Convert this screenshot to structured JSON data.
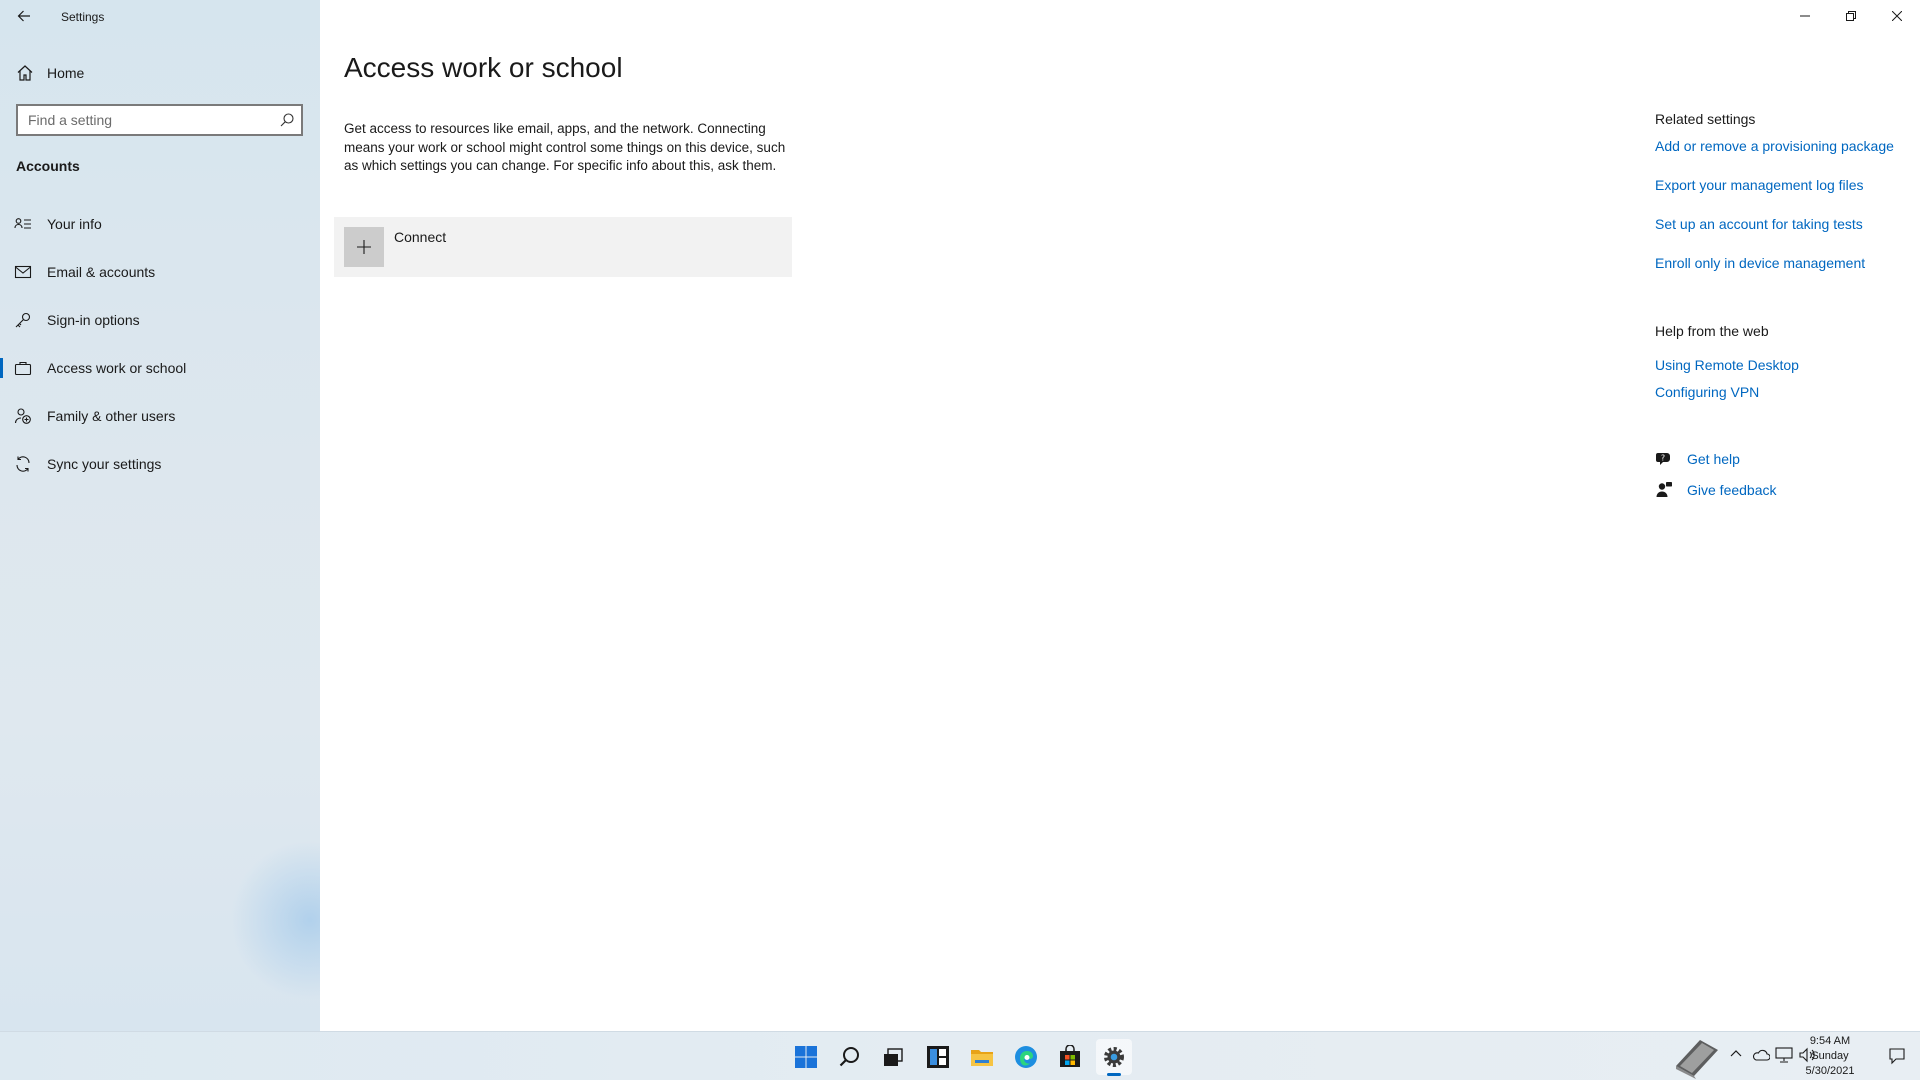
{
  "window": {
    "title": "Settings",
    "back_icon": "back-arrow-icon",
    "controls": [
      "minimize-icon",
      "restore-icon",
      "close-icon"
    ]
  },
  "sidebar": {
    "home_label": "Home",
    "search_placeholder": "Find a setting",
    "section_heading": "Accounts",
    "items": [
      {
        "label": "Your info",
        "icon": "contact-card-icon",
        "active": false
      },
      {
        "label": "Email & accounts",
        "icon": "mail-icon",
        "active": false
      },
      {
        "label": "Sign-in options",
        "icon": "key-icon",
        "active": false
      },
      {
        "label": "Access work or school",
        "icon": "briefcase-icon",
        "active": true
      },
      {
        "label": "Family & other users",
        "icon": "add-person-icon",
        "active": false
      },
      {
        "label": "Sync your settings",
        "icon": "sync-icon",
        "active": false
      }
    ]
  },
  "main": {
    "title": "Access work or school",
    "description": "Get access to resources like email, apps, and the network. Connecting means your work or school might control some things on this device, such as which settings you can change. For specific info about this, ask them.",
    "connect_label": "Connect"
  },
  "related": {
    "heading": "Related settings",
    "links": [
      "Add or remove a provisioning package",
      "Export your management log files",
      "Set up an account for taking tests",
      "Enroll only in device management"
    ],
    "help_heading": "Help from the web",
    "help_links": [
      "Using Remote Desktop",
      "Configuring VPN"
    ],
    "get_help": "Get help",
    "give_feedback": "Give feedback"
  },
  "taskbar": {
    "icons": [
      "start-icon",
      "search-icon",
      "task-view-icon",
      "widgets-icon",
      "file-explorer-icon",
      "edge-icon",
      "store-icon",
      "settings-icon"
    ],
    "active_icon": "settings-icon",
    "time": "9:54 AM",
    "day": "Sunday",
    "date": "5/30/2021"
  },
  "colors": {
    "accent": "#0067c0",
    "sidebar_bg": "#dde7ee",
    "tile_bg": "#f2f2f2"
  }
}
